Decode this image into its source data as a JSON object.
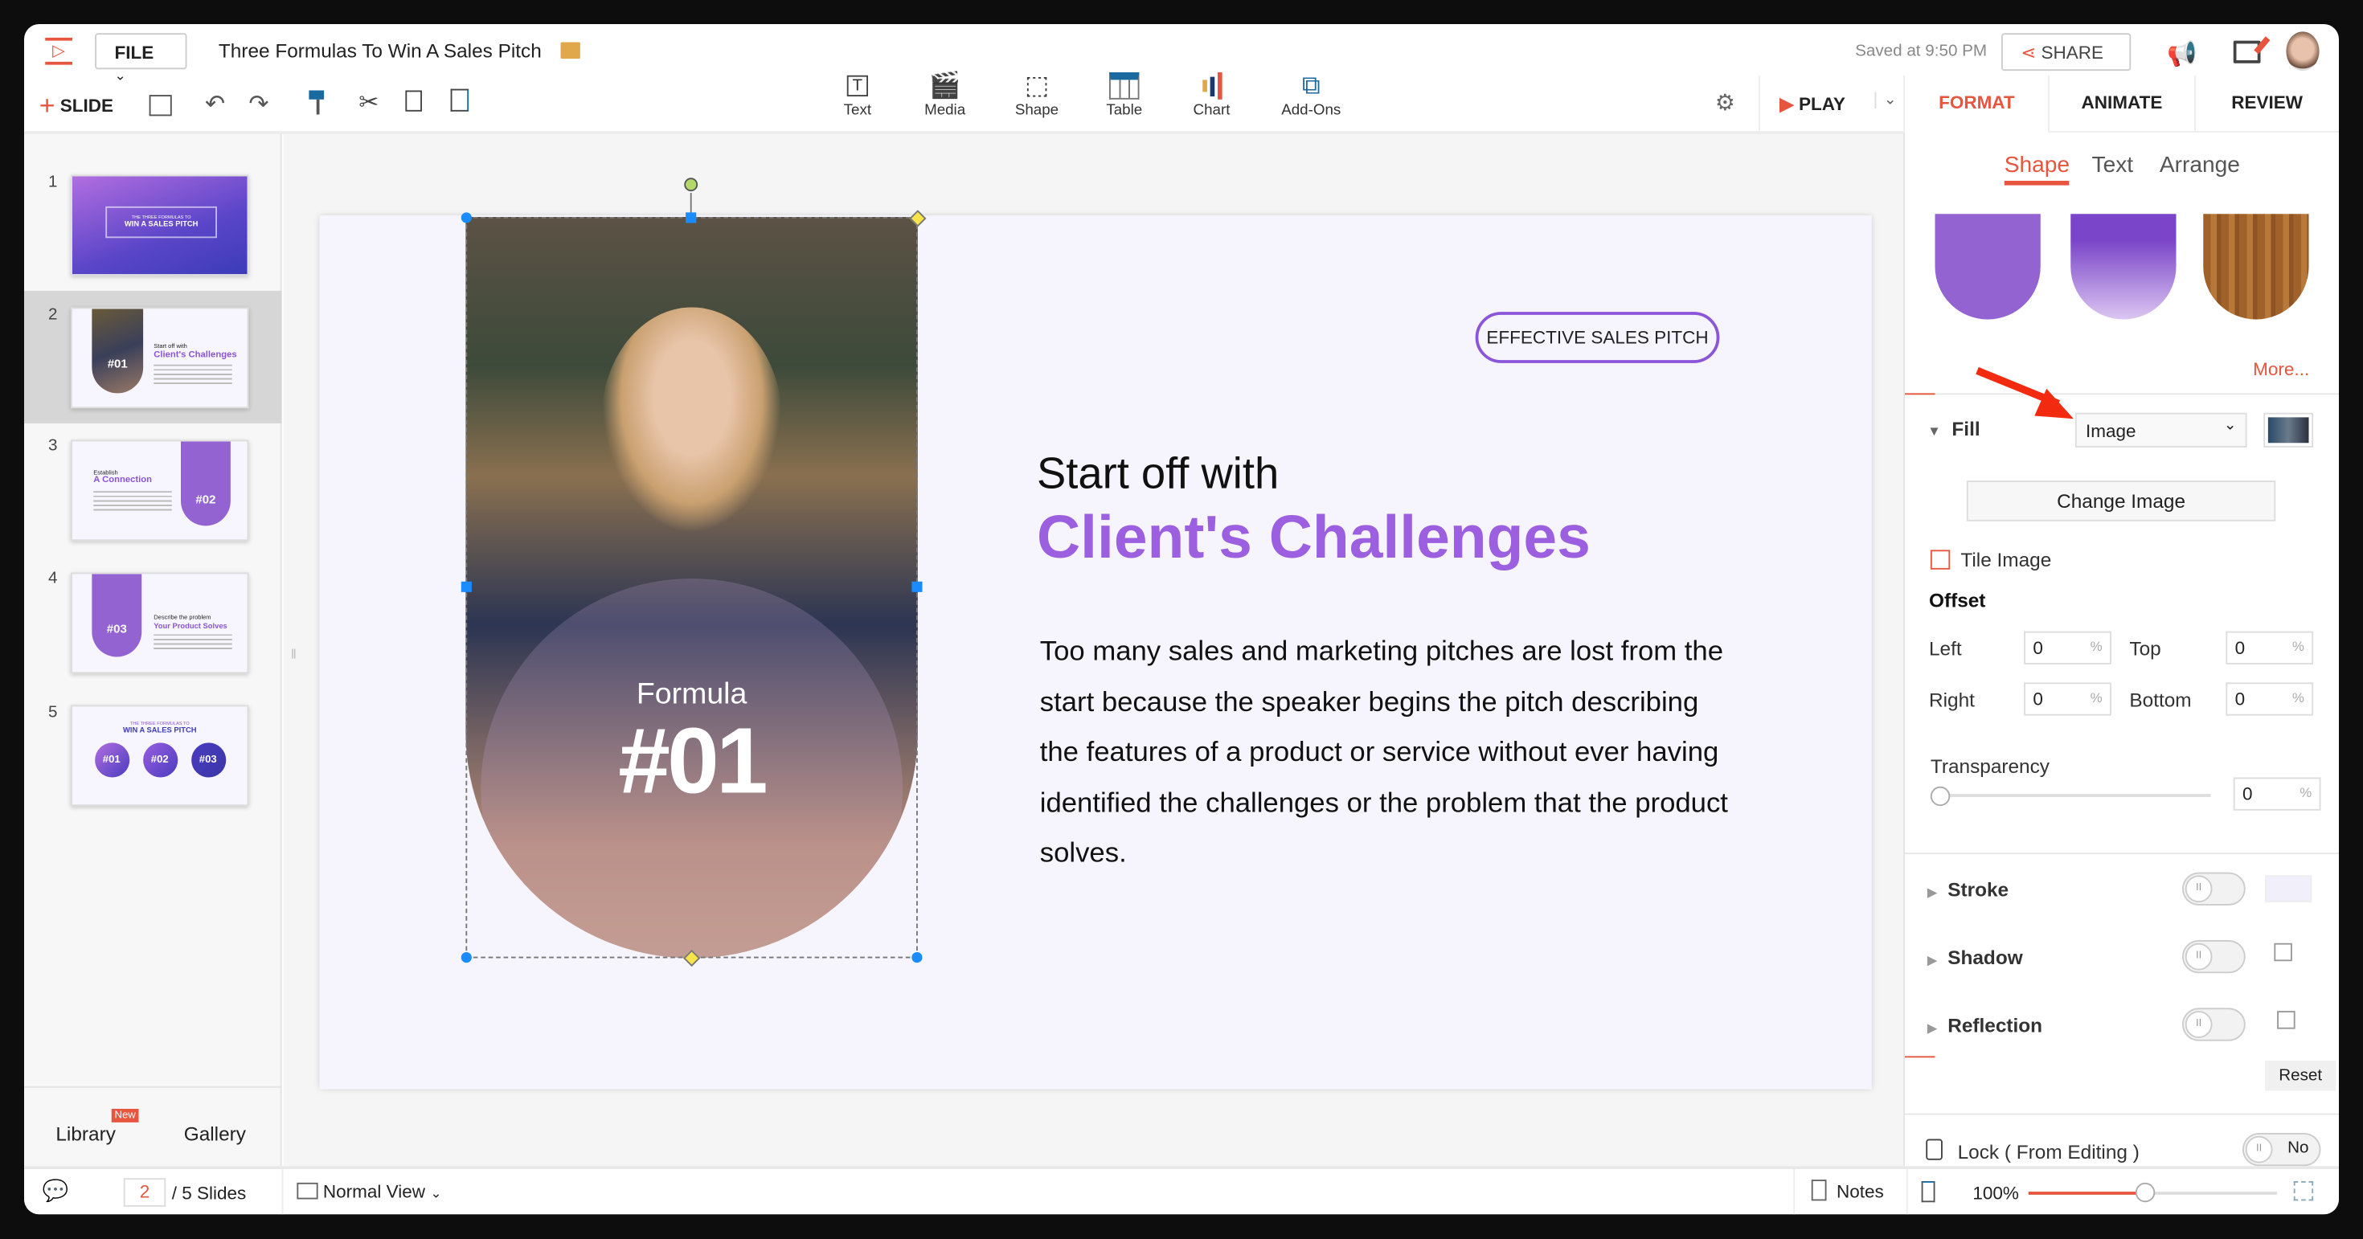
{
  "header": {
    "file_label": "FILE",
    "doc_title": "Three Formulas To Win A Sales Pitch",
    "saved_status": "Saved at 9:50 PM",
    "share_label": "SHARE",
    "slide_label": "SLIDE",
    "play_label": "PLAY"
  },
  "insert_toolbar": [
    {
      "label": "Text",
      "icon": "text-box-icon"
    },
    {
      "label": "Media",
      "icon": "media-clapper-icon"
    },
    {
      "label": "Shape",
      "icon": "shape-icon"
    },
    {
      "label": "Table",
      "icon": "table-icon"
    },
    {
      "label": "Chart",
      "icon": "bar-chart-icon"
    },
    {
      "label": "Add-Ons",
      "icon": "puzzle-icon"
    }
  ],
  "panel_tabs": [
    "FORMAT",
    "ANIMATE",
    "REVIEW"
  ],
  "format_subtabs": [
    "Shape",
    "Text",
    "Arrange"
  ],
  "slides": [
    {
      "num": "1",
      "pre": "THE THREE FORMULAS TO",
      "title": "WIN A SALES PITCH"
    },
    {
      "num": "2",
      "pre": "Start off with",
      "title": "Client's Challenges",
      "badge": "#01"
    },
    {
      "num": "3",
      "pre": "Establish",
      "title": "A Connection",
      "badge": "#02"
    },
    {
      "num": "4",
      "pre": "Describe the problem",
      "title": "Your Product Solves",
      "badge": "#03"
    },
    {
      "num": "5",
      "pre": "THE THREE FORMULAS TO",
      "title": "WIN A SALES PITCH",
      "badges": [
        "#01",
        "#02",
        "#03"
      ]
    }
  ],
  "left_bottom": {
    "library": "Library",
    "new_badge": "New",
    "gallery": "Gallery"
  },
  "slide": {
    "tag": "EFFECTIVE SALES PITCH",
    "subtitle": "Start off with",
    "title": "Client's Challenges",
    "body": "Too many sales and marketing pitches are lost from the start because the speaker begins the pitch describing the features of a product or service without ever having identified the challenges or the problem that the product solves.",
    "formula_label": "Formula",
    "formula_num": "#01"
  },
  "format_panel": {
    "more_link": "More...",
    "fill_label": "Fill",
    "fill_type": "Image",
    "change_image": "Change Image",
    "tile_image": "Tile Image",
    "offset_label": "Offset",
    "offset": {
      "left_label": "Left",
      "left": "0",
      "top_label": "Top",
      "top": "0",
      "right_label": "Right",
      "right": "0",
      "bottom_label": "Bottom",
      "bottom": "0"
    },
    "unit": "%",
    "transparency_label": "Transparency",
    "transparency": "0",
    "stroke": "Stroke",
    "shadow": "Shadow",
    "reflection": "Reflection",
    "reset": "Reset",
    "lock_label": "Lock ( From Editing )",
    "lock_value": "No"
  },
  "status_bar": {
    "current_slide": "2",
    "total": "/ 5 Slides",
    "view": "Normal View",
    "notes": "Notes",
    "zoom": "100%"
  },
  "colors": {
    "accent": "#e8553f",
    "purple": "#9b5fe0",
    "slide_bg": "#f6f4fd"
  }
}
